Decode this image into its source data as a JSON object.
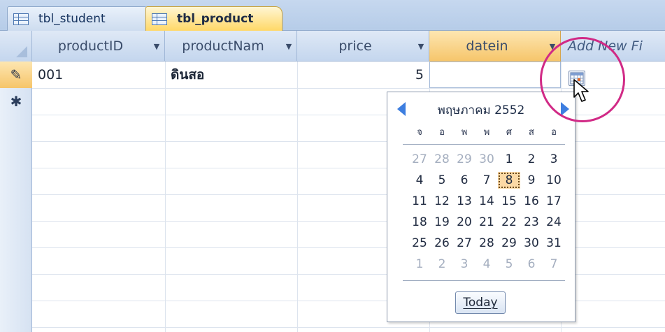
{
  "tabs": [
    {
      "label": "tbl_student",
      "active": false
    },
    {
      "label": "tbl_product",
      "active": true
    }
  ],
  "columns": [
    {
      "label": "productID"
    },
    {
      "label": "productNam"
    },
    {
      "label": "price"
    },
    {
      "label": "datein"
    },
    {
      "label": "Add New Fi"
    }
  ],
  "rows": [
    {
      "selector": "✎",
      "productID": "001",
      "productName": "ดินสอ",
      "price": "5",
      "datein": ""
    },
    {
      "selector": "✱"
    }
  ],
  "calendar": {
    "month_label": "พฤษภาคม 2552",
    "weekdays": [
      "จ",
      "อ",
      "พ",
      "พ",
      "ศ",
      "ส",
      "อ"
    ],
    "weeks": [
      [
        "27",
        "28",
        "29",
        "30",
        "1",
        "2",
        "3"
      ],
      [
        "4",
        "5",
        "6",
        "7",
        "8",
        "9",
        "10"
      ],
      [
        "11",
        "12",
        "13",
        "14",
        "15",
        "16",
        "17"
      ],
      [
        "18",
        "19",
        "20",
        "21",
        "22",
        "23",
        "24"
      ],
      [
        "25",
        "26",
        "27",
        "28",
        "29",
        "30",
        "31"
      ],
      [
        "1",
        "2",
        "3",
        "4",
        "5",
        "6",
        "7"
      ]
    ],
    "selected_day": "8",
    "today_label": "Today"
  },
  "colors": {
    "accent_tab": "#ffd867",
    "selected_header": "#f6c56a",
    "annotation_ring": "#d12a86",
    "nav_arrow": "#3d7ee0"
  }
}
